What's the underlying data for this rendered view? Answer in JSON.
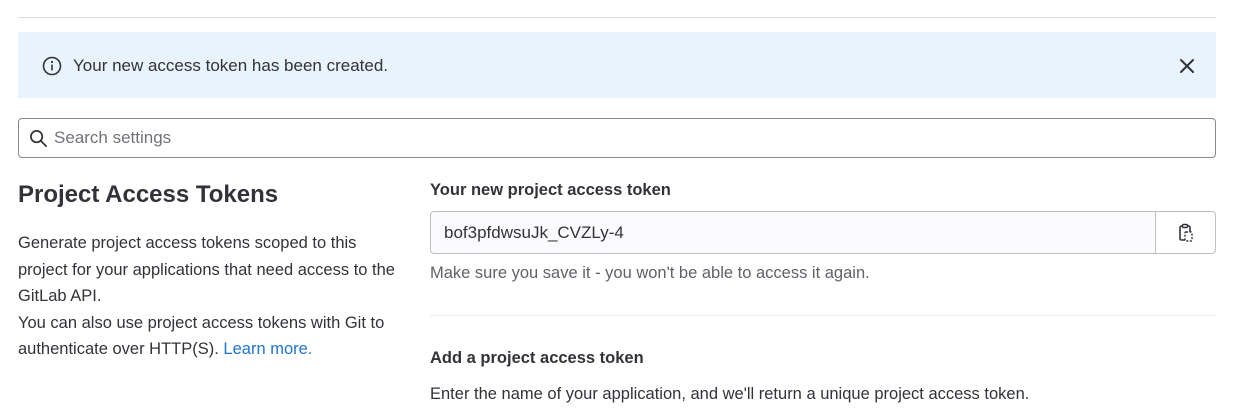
{
  "alert": {
    "message": "Your new access token has been created.",
    "icon": "info-icon",
    "close_icon": "close-icon",
    "background": "#e9f3fc"
  },
  "search": {
    "placeholder": "Search settings",
    "value": ""
  },
  "section": {
    "title": "Project Access Tokens",
    "description_1": "Generate project access tokens scoped to this project for your applications that need access to the GitLab API.",
    "description_2": "You can also use project access tokens with Git to authenticate over HTTP(S).",
    "learn_more": "Learn more."
  },
  "new_token": {
    "label": "Your new project access token",
    "value": "bof3pfdwsuJk_CVZLy-4",
    "copy_icon": "clipboard-icon",
    "help": "Make sure you save it - you won't be able to access it again."
  },
  "add_token": {
    "title": "Add a project access token",
    "description": "Enter the name of your application, and we'll return a unique project access token."
  },
  "colors": {
    "link": "#1f75cb",
    "text": "#333238",
    "muted": "#626168"
  }
}
